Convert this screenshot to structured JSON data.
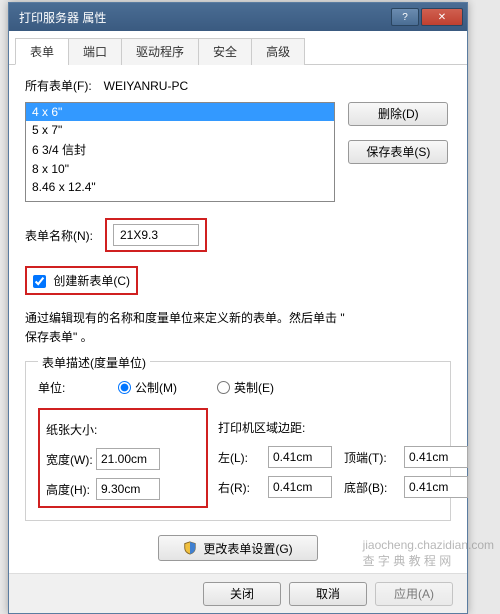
{
  "window": {
    "title": "打印服务器 属性"
  },
  "tabs": [
    "表单",
    "端口",
    "驱动程序",
    "安全",
    "高级"
  ],
  "forms": {
    "all_forms_label": "所有表单(F):",
    "all_forms_value": "WEIYANRU-PC",
    "items": [
      "4 x 6\"",
      "5 x 7\"",
      "6 3/4 信封",
      "8 x 10\"",
      "8.46 x 12.4\""
    ],
    "delete_btn": "删除(D)",
    "save_btn": "保存表单(S)"
  },
  "form_name": {
    "label": "表单名称(N):",
    "value": "21X9.3"
  },
  "create_new": {
    "label": "创建新表单(C)"
  },
  "hint": {
    "line1": "通过编辑现有的名称和度量单位来定义新的表单。然后单击 \"",
    "line2": "保存表单\" 。"
  },
  "measure": {
    "legend": "表单描述(度量单位)",
    "unit_label": "单位:",
    "metric": "公制(M)",
    "imperial": "英制(E)",
    "paper_size": "纸张大小:",
    "margins": "打印机区域边距:",
    "width_l": "宽度(W):",
    "width_v": "21.00cm",
    "height_l": "高度(H):",
    "height_v": "9.30cm",
    "left_l": "左(L):",
    "left_v": "0.41cm",
    "right_l": "右(R):",
    "right_v": "0.41cm",
    "top_l": "顶端(T):",
    "top_v": "0.41cm",
    "bottom_l": "底部(B):",
    "bottom_v": "0.41cm"
  },
  "change_btn": "更改表单设置(G)",
  "footer": {
    "close": "关闭",
    "cancel": "取消",
    "apply": "应用(A)"
  },
  "watermark": {
    "l1": "jiaocheng.chazidian.com",
    "l2": "查 字 典 教 程 网"
  }
}
